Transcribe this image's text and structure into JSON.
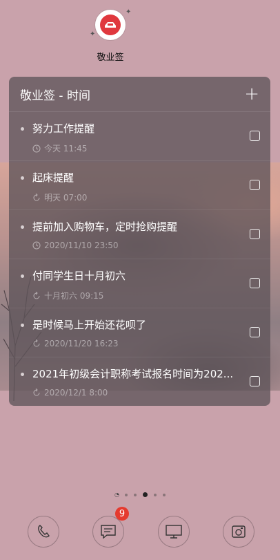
{
  "app": {
    "label": "敬业签"
  },
  "widget": {
    "title": "敬业签 - 时间",
    "add_label": "+",
    "items": [
      {
        "title": "努力工作提醒",
        "time": "今天 11:45",
        "icon": "clock-icon"
      },
      {
        "title": "起床提醒",
        "time": "明天 07:00",
        "icon": "repeat-icon"
      },
      {
        "title": "提前加入购物车，定时抢购提醒",
        "time": "2020/11/10 23:50",
        "icon": "clock-icon"
      },
      {
        "title": "付同学生日十月初六",
        "time": "十月初六 09:15",
        "icon": "repeat-icon"
      },
      {
        "title": "是时候马上开始还花呗了",
        "time": "2020/11/20 16:23",
        "icon": "repeat-icon"
      },
      {
        "title": "2021年初级会计职称考试报名时间为202...",
        "time": "2020/12/1 8:00",
        "icon": "repeat-icon"
      }
    ]
  },
  "dock": {
    "messages_badge": "9",
    "items": [
      "phone-icon",
      "messages-icon",
      "desktop-icon",
      "camera-icon"
    ]
  },
  "colors": {
    "accent": "#e0383e",
    "badge": "#e53a2f",
    "wallpaper": "#c9a2ab"
  }
}
